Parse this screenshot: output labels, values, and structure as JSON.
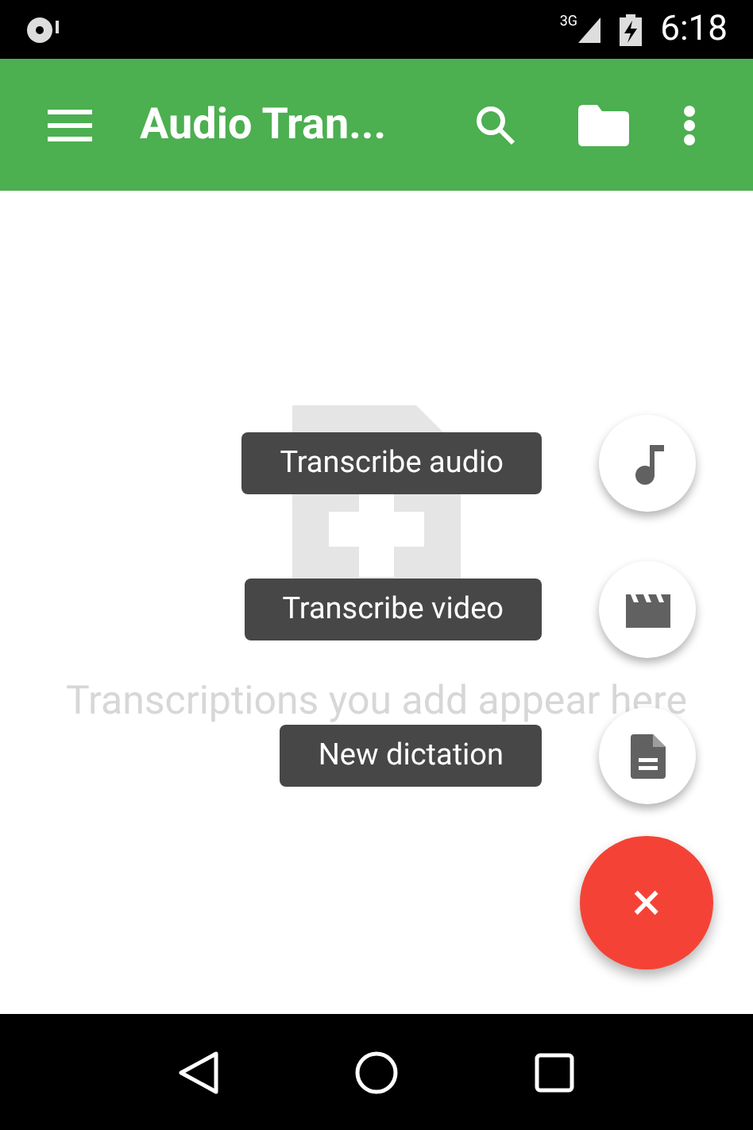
{
  "status_bar": {
    "network": "3G",
    "time": "6:18"
  },
  "toolbar": {
    "title": "Audio Tran..."
  },
  "empty_state": {
    "message": "Transcriptions you add appear here"
  },
  "fab_menu": {
    "expanded": true,
    "actions": [
      {
        "kind": "audio",
        "label": "Transcribe audio"
      },
      {
        "kind": "video",
        "label": "Transcribe video"
      },
      {
        "kind": "dictation",
        "label": "New dictation"
      }
    ],
    "close_symbol": "×"
  }
}
